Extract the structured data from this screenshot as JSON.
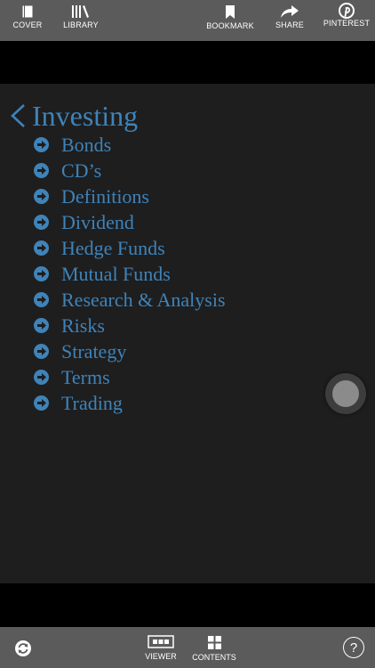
{
  "toolbar": {
    "cover": "COVER",
    "library": "LIBRARY",
    "bookmark": "BOOKMARK",
    "share": "SHARE",
    "pinterest": "PINTEREST"
  },
  "contents": {
    "title": "Investing",
    "items": [
      "Bonds",
      "CD’s",
      "Definitions",
      "Dividend",
      "Hedge Funds",
      "Mutual Funds",
      "Research & Analysis",
      "Risks",
      "Strategy",
      "Terms",
      "Trading"
    ]
  },
  "bottombar": {
    "viewer": "VIEWER",
    "contents": "CONTENTS",
    "help": "?"
  },
  "colors": {
    "toolbar_bg": "#5b5b5b",
    "page_bg": "#1e1e1f",
    "link_blue": "#3f83b8",
    "letterbox": "#000000"
  },
  "icons": {
    "cover": "book-icon",
    "library": "library-icon",
    "bookmark": "bookmark-icon",
    "share": "share-arrow-icon",
    "pinterest": "pinterest-icon",
    "back": "chevron-left-icon",
    "item": "circle-arrow-right-icon",
    "rotate": "rotate-icon",
    "viewer": "viewer-icon",
    "contents": "grid-icon",
    "help": "help-icon"
  }
}
